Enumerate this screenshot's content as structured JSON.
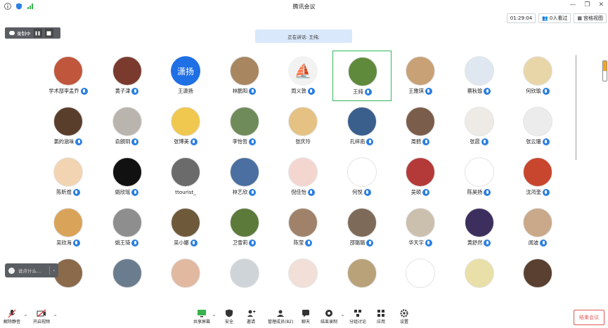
{
  "window": {
    "title": "腾讯会议"
  },
  "topbar": {
    "timer": "01:29:04",
    "participants": "0人看过",
    "view": "宫格视图"
  },
  "recording": {
    "label": "录制中"
  },
  "speaking": {
    "text": "正在讲话: 王纯;"
  },
  "chat": {
    "placeholder": "说点什么..."
  },
  "participants": [
    {
      "name": "学术部李孟乔",
      "mic": true,
      "color": "#c0563b",
      "textAvatar": ""
    },
    {
      "name": "黄子津",
      "mic": true,
      "color": "#7a3a2e",
      "textAvatar": ""
    },
    {
      "name": "王潇扬",
      "mic": false,
      "color": "#1f6fe5",
      "textAvatar": "潇扬"
    },
    {
      "name": "林鹏阳",
      "mic": true,
      "color": "#a88660",
      "textAvatar": ""
    },
    {
      "name": "周义敦",
      "mic": true,
      "color": "#f2f2f2",
      "textAvatar": "⛵"
    },
    {
      "name": "王纯",
      "mic": true,
      "color": "#5f8a3c",
      "textAvatar": "",
      "active": true
    },
    {
      "name": "王雅琪",
      "mic": true,
      "color": "#c9a177",
      "textAvatar": ""
    },
    {
      "name": "蔡秋瑜",
      "mic": true,
      "color": "#dfe8f0",
      "textAvatar": ""
    },
    {
      "name": "何欣瑜",
      "mic": true,
      "color": "#e8d6a8",
      "textAvatar": ""
    },
    {
      "name": "氯的滋味",
      "mic": true,
      "color": "#5a3e2c",
      "textAvatar": ""
    },
    {
      "name": "俞朗玥",
      "mic": true,
      "color": "#b9b4ad",
      "textAvatar": ""
    },
    {
      "name": "张博美",
      "mic": true,
      "color": "#f0c850",
      "textAvatar": ""
    },
    {
      "name": "李怡哲",
      "mic": true,
      "color": "#6f8b5a",
      "textAvatar": ""
    },
    {
      "name": "张庆玲",
      "mic": false,
      "color": "#e5c283",
      "textAvatar": ""
    },
    {
      "name": "孔祥南",
      "mic": true,
      "color": "#3a5f8c",
      "textAvatar": ""
    },
    {
      "name": "周鹤",
      "mic": true,
      "color": "#7a5d4a",
      "textAvatar": ""
    },
    {
      "name": "张晨",
      "mic": true,
      "color": "#eeeae6",
      "textAvatar": ""
    },
    {
      "name": "张云珊",
      "mic": true,
      "color": "#ececec",
      "textAvatar": ""
    },
    {
      "name": "陈昕煜",
      "mic": true,
      "color": "#f2d4b2",
      "textAvatar": ""
    },
    {
      "name": "姚欣瑶",
      "mic": true,
      "color": "#111111",
      "textAvatar": ""
    },
    {
      "name": "ttourist_",
      "mic": false,
      "color": "#6b6b6b",
      "textAvatar": ""
    },
    {
      "name": "林艺欣",
      "mic": true,
      "color": "#4a6fa0",
      "textAvatar": ""
    },
    {
      "name": "倪佳怡",
      "mic": true,
      "color": "#f4d6d0",
      "textAvatar": ""
    },
    {
      "name": "何悦",
      "mic": true,
      "color": "#ffffff",
      "textAvatar": ""
    },
    {
      "name": "吴硕",
      "mic": true,
      "color": "#b43a3a",
      "textAvatar": ""
    },
    {
      "name": "陈昊扬",
      "mic": true,
      "color": "#ffffff",
      "textAvatar": ""
    },
    {
      "name": "沈鸿奎",
      "mic": true,
      "color": "#c8452e",
      "textAvatar": ""
    },
    {
      "name": "吴欣海",
      "mic": true,
      "color": "#d9a35a",
      "textAvatar": ""
    },
    {
      "name": "姚王琦",
      "mic": true,
      "color": "#8e8e8e",
      "textAvatar": ""
    },
    {
      "name": "吴小娜",
      "mic": true,
      "color": "#6e5a3a",
      "textAvatar": ""
    },
    {
      "name": "卫雪莉",
      "mic": true,
      "color": "#5c7a3a",
      "textAvatar": ""
    },
    {
      "name": "陈莹",
      "mic": true,
      "color": "#a0826a",
      "textAvatar": ""
    },
    {
      "name": "邵璐璐",
      "mic": true,
      "color": "#7e6a58",
      "textAvatar": ""
    },
    {
      "name": "华天宇",
      "mic": true,
      "color": "#cbbfae",
      "textAvatar": ""
    },
    {
      "name": "黄舒然",
      "mic": true,
      "color": "#3c2f5e",
      "textAvatar": ""
    },
    {
      "name": "闻波",
      "mic": true,
      "color": "#c9a98a",
      "textAvatar": ""
    },
    {
      "name": "",
      "mic": false,
      "color": "#8a6a4a",
      "textAvatar": ""
    },
    {
      "name": "",
      "mic": false,
      "color": "#6a7d8e",
      "textAvatar": ""
    },
    {
      "name": "",
      "mic": false,
      "color": "#e1b9a0",
      "textAvatar": ""
    },
    {
      "name": "",
      "mic": false,
      "color": "#cfd4d8",
      "textAvatar": ""
    },
    {
      "name": "",
      "mic": false,
      "color": "#f2e0d8",
      "textAvatar": ""
    },
    {
      "name": "",
      "mic": false,
      "color": "#b9a27a",
      "textAvatar": ""
    },
    {
      "name": "",
      "mic": false,
      "color": "#ffffff",
      "textAvatar": ""
    },
    {
      "name": "",
      "mic": false,
      "color": "#e9dfa8",
      "textAvatar": ""
    },
    {
      "name": "",
      "mic": false,
      "color": "#5a4030",
      "textAvatar": ""
    }
  ],
  "toolbar": {
    "unmute": "解除静音",
    "video": "开启视频",
    "share": "共享屏幕",
    "security": "安全",
    "invite": "邀请",
    "manage": "管理成员(82)",
    "chat": "聊天",
    "record": "结束录制",
    "breakout": "分组讨论",
    "apps": "应用",
    "settings": "设置",
    "end": "结束会议"
  }
}
